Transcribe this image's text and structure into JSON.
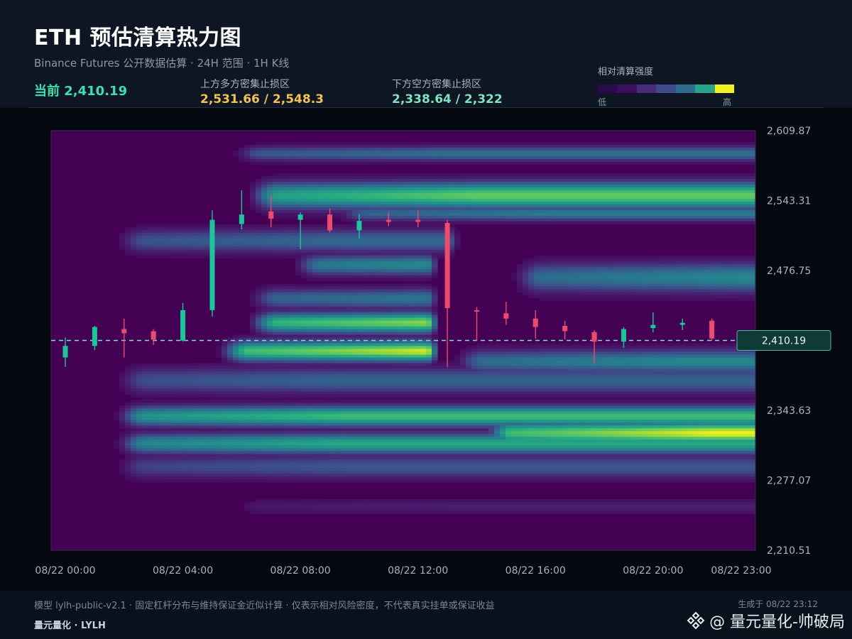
{
  "header": {
    "title": "ETH 预估清算热力图",
    "subtitle": "Binance Futures 公开数据估算 · 24H 范围 · 1H K线",
    "current_label": "当前 2,410.19",
    "upper_zone_label": "上方多方密集止损区",
    "upper_zone_value": "2,531.66 / 2,548.3",
    "lower_zone_label": "下方空方密集止损区",
    "lower_zone_value": "2,338.64 / 2,322",
    "legend_title": "相对清算强度",
    "legend_low": "低",
    "legend_high": "高",
    "legend_colors": [
      "#2a0a4a",
      "#3b0f5e",
      "#4a2a7a",
      "#3e4a8a",
      "#2e6d8e",
      "#27a38a",
      "#f0f020"
    ]
  },
  "chart_data": {
    "type": "heatmap",
    "ylim": [
      2210.51,
      2609.87
    ],
    "yticks": [
      "2,609.87",
      "2,543.31",
      "2,476.75",
      "2,410.19",
      "2,343.63",
      "2,277.07",
      "2,210.51"
    ],
    "ytick_values": [
      2609.87,
      2543.31,
      2476.75,
      2410.19,
      2343.63,
      2277.07,
      2210.51
    ],
    "xticks": [
      "08/22 00:00",
      "08/22 04:00",
      "08/22 08:00",
      "08/22 12:00",
      "08/22 16:00",
      "08/22 20:00",
      "08/22 23:00"
    ],
    "xtick_hours": [
      0,
      4,
      8,
      12,
      16,
      20,
      23
    ],
    "current_price": 2410.19,
    "current_price_label": "2,410.19",
    "up_color": "#19c79a",
    "down_color": "#ee4a6e",
    "bands": [
      {
        "price": 2588,
        "sigma": 5,
        "start": 5.5,
        "end": 24,
        "peak": 0.45
      },
      {
        "price": 2548,
        "sigma": 9,
        "start": 6,
        "end": 24,
        "peak": 0.85
      },
      {
        "price": 2531,
        "sigma": 5,
        "start": 9,
        "end": 24,
        "peak": 0.5
      },
      {
        "price": 2505,
        "sigma": 8,
        "start": 1.5,
        "end": 13.5,
        "peak": 0.42
      },
      {
        "price": 2482,
        "sigma": 7,
        "start": 7.5,
        "end": 12.8,
        "peak": 0.62
      },
      {
        "price": 2470,
        "sigma": 10,
        "start": 15,
        "end": 24,
        "peak": 0.55
      },
      {
        "price": 2450,
        "sigma": 7,
        "start": 6,
        "end": 12.8,
        "peak": 0.5
      },
      {
        "price": 2427,
        "sigma": 7,
        "start": 6,
        "end": 12.8,
        "peak": 0.95
      },
      {
        "price": 2400,
        "sigma": 7,
        "start": 5,
        "end": 12.8,
        "peak": 1.0
      },
      {
        "price": 2390,
        "sigma": 8,
        "start": 13,
        "end": 24,
        "peak": 0.55
      },
      {
        "price": 2372,
        "sigma": 9,
        "start": 1.5,
        "end": 24,
        "peak": 0.4
      },
      {
        "price": 2338,
        "sigma": 7,
        "start": 1.5,
        "end": 24,
        "peak": 0.78
      },
      {
        "price": 2322,
        "sigma": 8,
        "start": 14,
        "end": 24,
        "peak": 1.0
      },
      {
        "price": 2312,
        "sigma": 7,
        "start": 1.5,
        "end": 24,
        "peak": 0.7
      },
      {
        "price": 2290,
        "sigma": 8,
        "start": 1.5,
        "end": 24,
        "peak": 0.35
      },
      {
        "price": 2252,
        "sigma": 5,
        "start": 5.5,
        "end": 24,
        "peak": 0.15
      }
    ],
    "candles": [
      {
        "o": 2394,
        "h": 2413,
        "l": 2385,
        "c": 2405
      },
      {
        "o": 2405,
        "h": 2424,
        "l": 2401,
        "c": 2423
      },
      {
        "o": 2421,
        "h": 2431,
        "l": 2394,
        "c": 2417
      },
      {
        "o": 2419,
        "h": 2421,
        "l": 2406,
        "c": 2411
      },
      {
        "o": 2410,
        "h": 2446,
        "l": 2409,
        "c": 2439
      },
      {
        "o": 2439,
        "h": 2534,
        "l": 2433,
        "c": 2525
      },
      {
        "o": 2521,
        "h": 2553,
        "l": 2516,
        "c": 2530
      },
      {
        "o": 2533,
        "h": 2549,
        "l": 2518,
        "c": 2526
      },
      {
        "o": 2525,
        "h": 2532,
        "l": 2497,
        "c": 2530
      },
      {
        "o": 2530,
        "h": 2536,
        "l": 2513,
        "c": 2515
      },
      {
        "o": 2515,
        "h": 2530,
        "l": 2507,
        "c": 2524
      },
      {
        "o": 2525,
        "h": 2532,
        "l": 2519,
        "c": 2523
      },
      {
        "o": 2525,
        "h": 2534,
        "l": 2518,
        "c": 2523
      },
      {
        "o": 2522,
        "h": 2525,
        "l": 2385,
        "c": 2441
      },
      {
        "o": 2439,
        "h": 2442,
        "l": 2410,
        "c": 2438
      },
      {
        "o": 2436,
        "h": 2447,
        "l": 2425,
        "c": 2431
      },
      {
        "o": 2431,
        "h": 2439,
        "l": 2412,
        "c": 2423
      },
      {
        "o": 2424,
        "h": 2429,
        "l": 2411,
        "c": 2419
      },
      {
        "o": 2418,
        "h": 2420,
        "l": 2388,
        "c": 2409
      },
      {
        "o": 2409,
        "h": 2423,
        "l": 2403,
        "c": 2421
      },
      {
        "o": 2422,
        "h": 2437,
        "l": 2418,
        "c": 2425
      },
      {
        "o": 2425,
        "h": 2431,
        "l": 2420,
        "c": 2427
      },
      {
        "o": 2429,
        "h": 2431,
        "l": 2410,
        "c": 2412
      }
    ]
  },
  "footer": {
    "model_note": "模型 lylh-public-v2.1 · 固定杠杆分布与维持保证金近似计算 · 仅表示相对风险密度，不代表真实挂单或保证收益",
    "generated": "生成于 08/22 23:12",
    "brand": "量元量化 · LYLH",
    "watermark": "@ 量元量化-帅破局"
  }
}
